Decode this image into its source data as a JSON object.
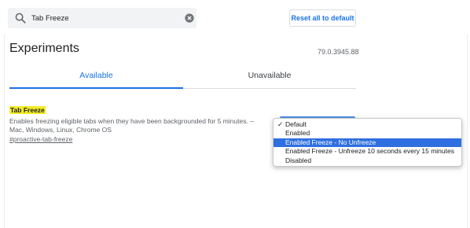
{
  "search": {
    "value": "Tab Freeze",
    "icon": "search-icon",
    "clear_icon": "close-circle-icon"
  },
  "toolbar": {
    "reset_label": "Reset all to default"
  },
  "header": {
    "title": "Experiments",
    "version": "79.0.3945.88"
  },
  "tabs": [
    {
      "label": "Available",
      "active": true
    },
    {
      "label": "Unavailable",
      "active": false
    }
  ],
  "colors": {
    "accent": "#1a73e8",
    "highlight": "#f4ec25",
    "menu_selected": "#2f6fe0"
  },
  "experiment": {
    "title": "Tab Freeze",
    "description": "Enables freezing eligible tabs when they have been backgrounded for 5 minutes. – Mac, Windows, Linux, Chrome OS",
    "link": "#proactive-tab-freeze"
  },
  "dropdown": {
    "check_mark": "✓",
    "options": [
      {
        "label": "Default",
        "checked": true,
        "highlighted": false
      },
      {
        "label": "Enabled",
        "checked": false,
        "highlighted": false
      },
      {
        "label": "Enabled Freeze - No Unfreeze",
        "checked": false,
        "highlighted": true
      },
      {
        "label": "Enabled Freeze - Unfreeze 10 seconds every 15 minutes",
        "checked": false,
        "highlighted": false
      },
      {
        "label": "Disabled",
        "checked": false,
        "highlighted": false
      }
    ]
  }
}
